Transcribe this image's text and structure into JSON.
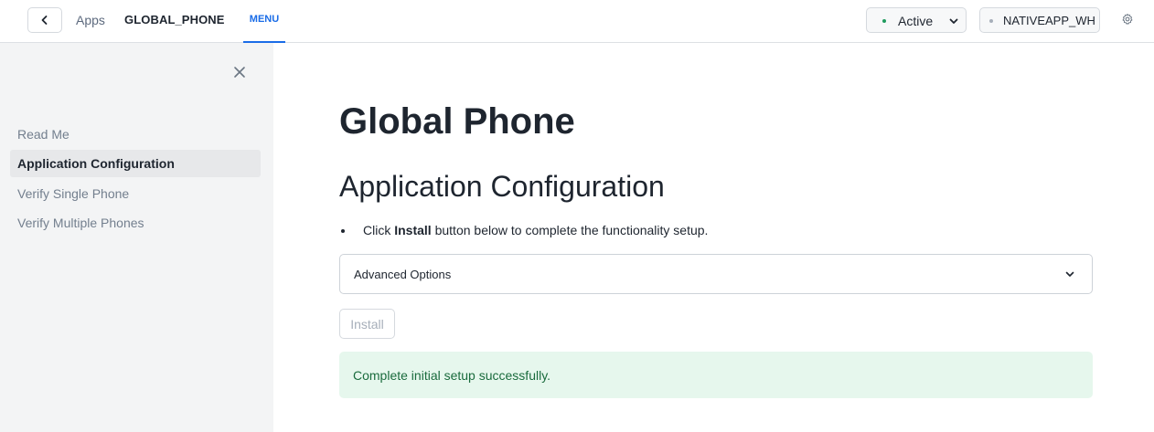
{
  "header": {
    "breadcrumb_apps": "Apps",
    "app_name": "GLOBAL_PHONE",
    "tab_menu": "MENU",
    "status": "Active",
    "warehouse": "NATIVEAPP_WH"
  },
  "sidebar": {
    "items": [
      {
        "label": "Read Me"
      },
      {
        "label": "Application Configuration"
      },
      {
        "label": "Verify Single Phone"
      },
      {
        "label": "Verify Multiple Phones"
      }
    ]
  },
  "main": {
    "title": "Global Phone",
    "subtitle": "Application Configuration",
    "instruction_prefix": "Click ",
    "instruction_bold": "Install",
    "instruction_suffix": " button below to complete the functionality setup.",
    "advanced_label": "Advanced Options",
    "install_label": "Install",
    "success_message": "Complete initial setup successfully."
  },
  "colors": {
    "accent": "#1a6ce7",
    "status_active": "#1f9b5e",
    "success_bg": "#e6f7ed",
    "success_text": "#1a6b3d"
  },
  "icons": [
    "chevron-left-icon",
    "chevron-down-icon",
    "gear-icon",
    "close-icon"
  ]
}
